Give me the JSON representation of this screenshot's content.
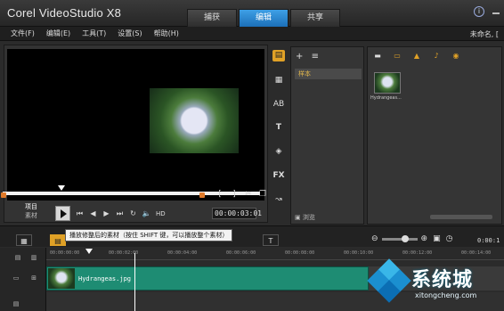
{
  "app": {
    "title": "Corel VideoStudio X8",
    "project_name": "未命名, ["
  },
  "tabs": [
    {
      "label": "捕获",
      "active": false
    },
    {
      "label": "编辑",
      "active": true
    },
    {
      "label": "共享",
      "active": false
    }
  ],
  "menu": [
    "文件(F)",
    "编辑(E)",
    "工具(T)",
    "设置(S)",
    "帮助(H)"
  ],
  "player": {
    "mode_project": "项目",
    "mode_clip": "素材",
    "timecode": "00:00:03:01",
    "hd_label": "HD",
    "transport_icons": [
      "play-icon",
      "home-icon",
      "prev-frame-icon",
      "next-frame-icon",
      "end-icon",
      "repeat-icon",
      "volume-icon"
    ],
    "trim_icons": [
      "mark-in-icon",
      "mark-out-icon",
      "split-icon",
      "copy-icon"
    ]
  },
  "tooltip": "播放修整后的素材（按住 SHIFT 键，可以播放整个素材）",
  "library": {
    "folder": "样本",
    "browse": "浏览",
    "side_icons": [
      "media-icon",
      "instant-project-icon",
      "transition-icon",
      "title-icon",
      "graphic-icon",
      "fx-icon",
      "path-icon"
    ]
  },
  "media": {
    "toolbar_icons": [
      "folder-icon",
      "video-filter-icon",
      "photo-filter-icon",
      "audio-filter-icon",
      "sort-icon"
    ],
    "items": [
      {
        "name": "Hydrangeas..."
      }
    ]
  },
  "timeline": {
    "ruler_ticks": [
      "00:00:00:00",
      "00:00:02:00",
      "00:00:04:00",
      "00:00:06:00",
      "00:00:08:00",
      "00:00:10:00",
      "00:00:12:00",
      "00:00:14:00"
    ],
    "end_time": "0:00:1",
    "clip_label": "Hydrangeas.jpg"
  },
  "watermark": {
    "text": "系统城",
    "url": "xitongcheng.com"
  },
  "colors": {
    "accent": "#e0a126",
    "active_tab": "#2a86cf",
    "clip": "#1e8c73"
  }
}
